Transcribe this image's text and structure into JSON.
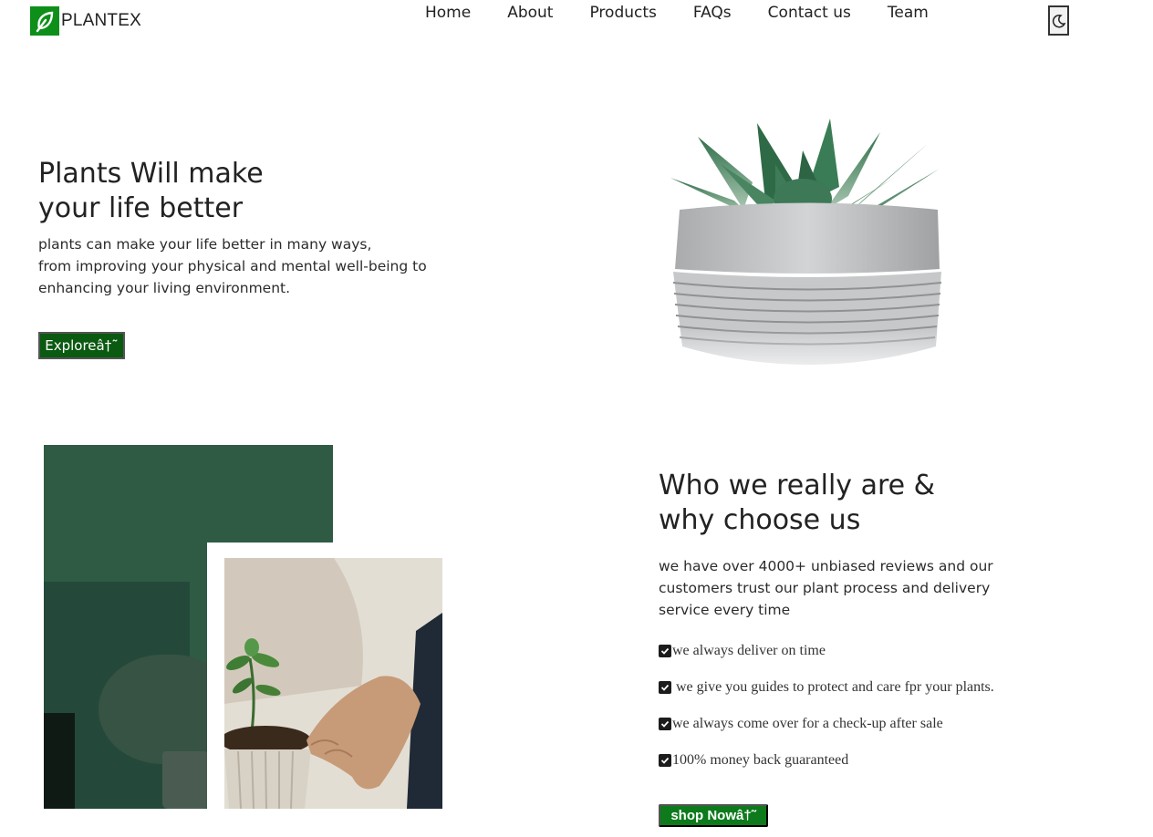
{
  "header": {
    "logo_text": "PLANTEX",
    "nav": [
      "Home",
      "About",
      "Products",
      "FAQs",
      "Contact us",
      "Team"
    ],
    "theme_toggle_icon": "moon-icon"
  },
  "hero": {
    "title_line1": "Plants Will make",
    "title_line2": "your life better",
    "subtitle_line1": "plants can make your life better in many ways,",
    "subtitle_line2": "from improving your physical and mental well-being to",
    "subtitle_line3": "enhancing your living environment.",
    "explore_label": "Exploreâ†˜",
    "image": "succulent-pot-image"
  },
  "about": {
    "title_line1": "Who we really are &",
    "title_line2": "why choose us",
    "subtitle_line1": "we have over 4000+ unbiased reviews and our",
    "subtitle_line2": "customers trust our plant process and delivery",
    "subtitle_line3": "service every time",
    "checks": [
      "we always deliver on time",
      " we give you guides to protect and care fpr your plants.",
      "we always come over for a check-up after sale",
      "100% money back guaranteed"
    ],
    "shop_label": "shop Nowâ†˜",
    "images": [
      "hands-holding-plant-dark-image",
      "hands-planting-seedling-image"
    ]
  },
  "colors": {
    "brand_green": "#0e8f1a",
    "explore_button": "#0b5a11",
    "shop_button": "#0d7a1c"
  }
}
